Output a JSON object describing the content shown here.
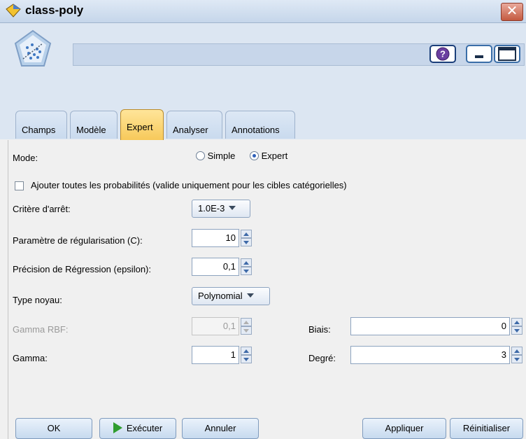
{
  "window": {
    "title": "class-poly",
    "close_glyph": "✕"
  },
  "header": {
    "field_value": "",
    "buttons": [
      "help-icon",
      "minimize-icon",
      "maximize-icon"
    ]
  },
  "tabs": [
    {
      "label": "Champs"
    },
    {
      "label": "Modèle"
    },
    {
      "label": "Expert",
      "active": true
    },
    {
      "label": "Analyser"
    },
    {
      "label": "Annotations"
    }
  ],
  "form": {
    "mode_label": "Mode:",
    "mode_simple": "Simple",
    "mode_expert": "Expert",
    "mode_selected": "Expert",
    "probs_label": "Ajouter toutes les probabilités (valide uniquement pour les cibles catégorielles)",
    "probs_checked": false,
    "stop_label": "Critère d'arrêt:",
    "stop_value": "1.0E-3",
    "c_label": "Paramètre de régularisation (C):",
    "c_value": "10",
    "eps_label": "Précision de Régression (epsilon):",
    "eps_value": "0,1",
    "kernel_label": "Type noyau:",
    "kernel_value": "Polynomial",
    "rbf_label": "Gamma RBF:",
    "rbf_value": "0,1",
    "gamma_label": "Gamma:",
    "gamma_value": "1",
    "bias_label": "Biais:",
    "bias_value": "0",
    "degree_label": "Degré:",
    "degree_value": "3"
  },
  "footer": {
    "ok": "OK",
    "run": "Exécuter",
    "cancel": "Annuler",
    "apply": "Appliquer",
    "reset": "Réinitialiser"
  },
  "colors": {
    "active_tab": "#f7c95a",
    "header_bg": "#dce6f2",
    "run_icon": "#2f9d2f"
  }
}
